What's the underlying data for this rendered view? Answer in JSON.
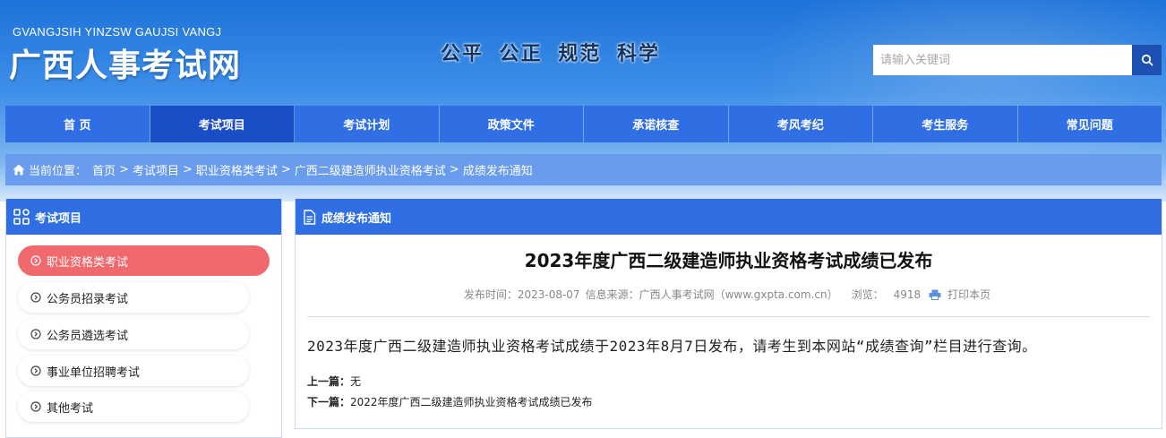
{
  "header": {
    "logo_en": "GVANGJSIH YINZSW GAUJSI VANGJ",
    "logo_cn": "广西人事考试网",
    "slogan": "公平  公正  规范  科学",
    "search_placeholder": "请输入关键词",
    "search_icon": "search-icon"
  },
  "nav": {
    "items": [
      {
        "label": "首 页"
      },
      {
        "label": "考试项目"
      },
      {
        "label": "考试计划"
      },
      {
        "label": "政策文件"
      },
      {
        "label": "承诺核查"
      },
      {
        "label": "考风考纪"
      },
      {
        "label": "考生服务"
      },
      {
        "label": "常见问题"
      }
    ],
    "active_index": 1
  },
  "breadcrumb": {
    "prefix": "当前位置：",
    "items": [
      "首页",
      "考试项目",
      "职业资格类考试",
      "广西二级建造师执业资格考试",
      "成绩发布通知"
    ],
    "separator": ">"
  },
  "sidebar": {
    "title": "考试项目",
    "items": [
      {
        "label": "职业资格类考试",
        "active": true
      },
      {
        "label": "公务员招录考试",
        "active": false
      },
      {
        "label": "公务员遴选考试",
        "active": false
      },
      {
        "label": "事业单位招聘考试",
        "active": false
      },
      {
        "label": "其他考试",
        "active": false
      }
    ]
  },
  "main": {
    "section_title": "成绩发布通知",
    "article_title": "2023年度广西二级建造师执业资格考试成绩已发布",
    "meta": {
      "publish_time": "发布时间：2023-08-07",
      "source": "信息来源：广西人事考试网（www.gxpta.com.cn）",
      "views_label": "浏览：",
      "views": "4918",
      "print_label": "打印本页"
    },
    "body": "2023年度广西二级建造师执业资格考试成绩于2023年8月7日发布，请考生到本网站“成绩查询”栏目进行查询。",
    "prev_label": "上一篇：",
    "prev_value": "无",
    "next_label": "下一篇：",
    "next_value": "2022年度广西二级建造师执业资格考试成绩已发布"
  },
  "colors": {
    "nav_bg": "#2f6fe3",
    "nav_active": "#1a4ec7",
    "breadcrumb_bg": "#6a9cee",
    "sidebar_active": "#f0696c"
  }
}
